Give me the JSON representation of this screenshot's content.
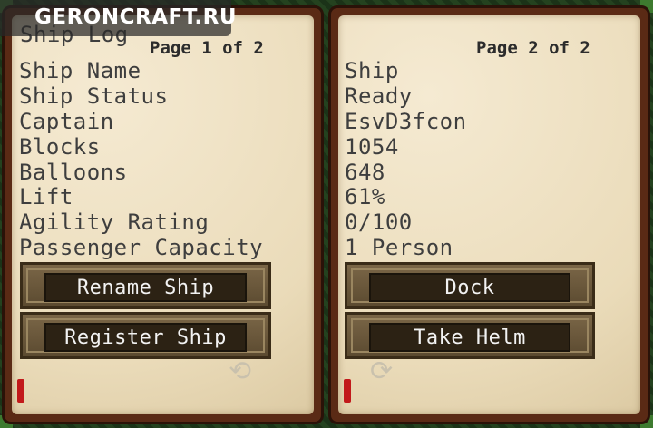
{
  "watermark": "GERONCRAFT.RU",
  "left_page": {
    "title": "Ship Log",
    "page_indicator": "Page 1 of 2",
    "labels": [
      "Ship Name",
      "Ship Status",
      "Captain",
      "Blocks",
      "Balloons",
      "Lift",
      "Agility Rating",
      "Passenger Capacity"
    ],
    "buttons": [
      "Rename Ship",
      "Register Ship"
    ],
    "next_arrow": "⟲"
  },
  "right_page": {
    "page_indicator": "Page 2 of 2",
    "values": [
      "Ship",
      "Ready",
      "EsvD3fcon",
      "1054",
      "648",
      "61%",
      "0/100",
      "1 Person"
    ],
    "buttons": [
      "Dock",
      "Take Helm"
    ],
    "prev_arrow": "⟳"
  }
}
